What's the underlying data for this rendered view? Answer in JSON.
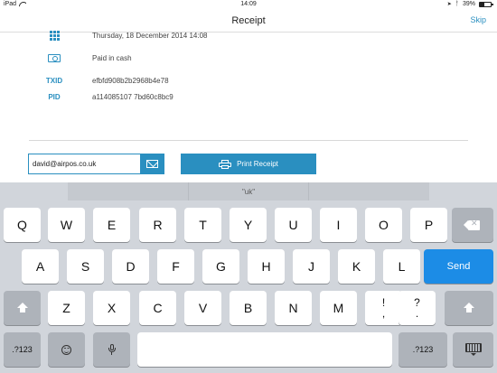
{
  "status_bar": {
    "device": "iPad",
    "time": "14:09",
    "battery_text": "39%",
    "battery_level": 0.39
  },
  "nav": {
    "title": "Receipt",
    "skip_label": "Skip"
  },
  "receipt": {
    "date": "Thursday, 18 December 2014 14:08",
    "payment_method": "Paid in cash",
    "txid_label": "TXID",
    "txid_value": "efbfd908b2b2968b4e78",
    "pid_label": "PID",
    "pid_value": "a114085107 7bd60c8bc9"
  },
  "email": {
    "value": "david@airpos.co.uk"
  },
  "print_button": {
    "label": "Print Receipt"
  },
  "keyboard": {
    "suggestions": [
      "",
      "\"uk\"",
      "",
      ""
    ],
    "row1": [
      "Q",
      "W",
      "E",
      "R",
      "T",
      "Y",
      "U",
      "I",
      "O",
      "P"
    ],
    "row2": [
      "A",
      "S",
      "D",
      "F",
      "G",
      "H",
      "J",
      "K",
      "L"
    ],
    "row3": [
      "Z",
      "X",
      "C",
      "V",
      "B",
      "N",
      "M"
    ],
    "send_label": "Send",
    "punct1_top": "!",
    "punct1_bottom": ",",
    "punct2_top": "?",
    "punct2_bottom": ".",
    "numbers_label": ".?123"
  },
  "colors": {
    "accent": "#2a8fc0",
    "send_key": "#1c8ce6",
    "keyboard_bg": "#d1d5db"
  }
}
